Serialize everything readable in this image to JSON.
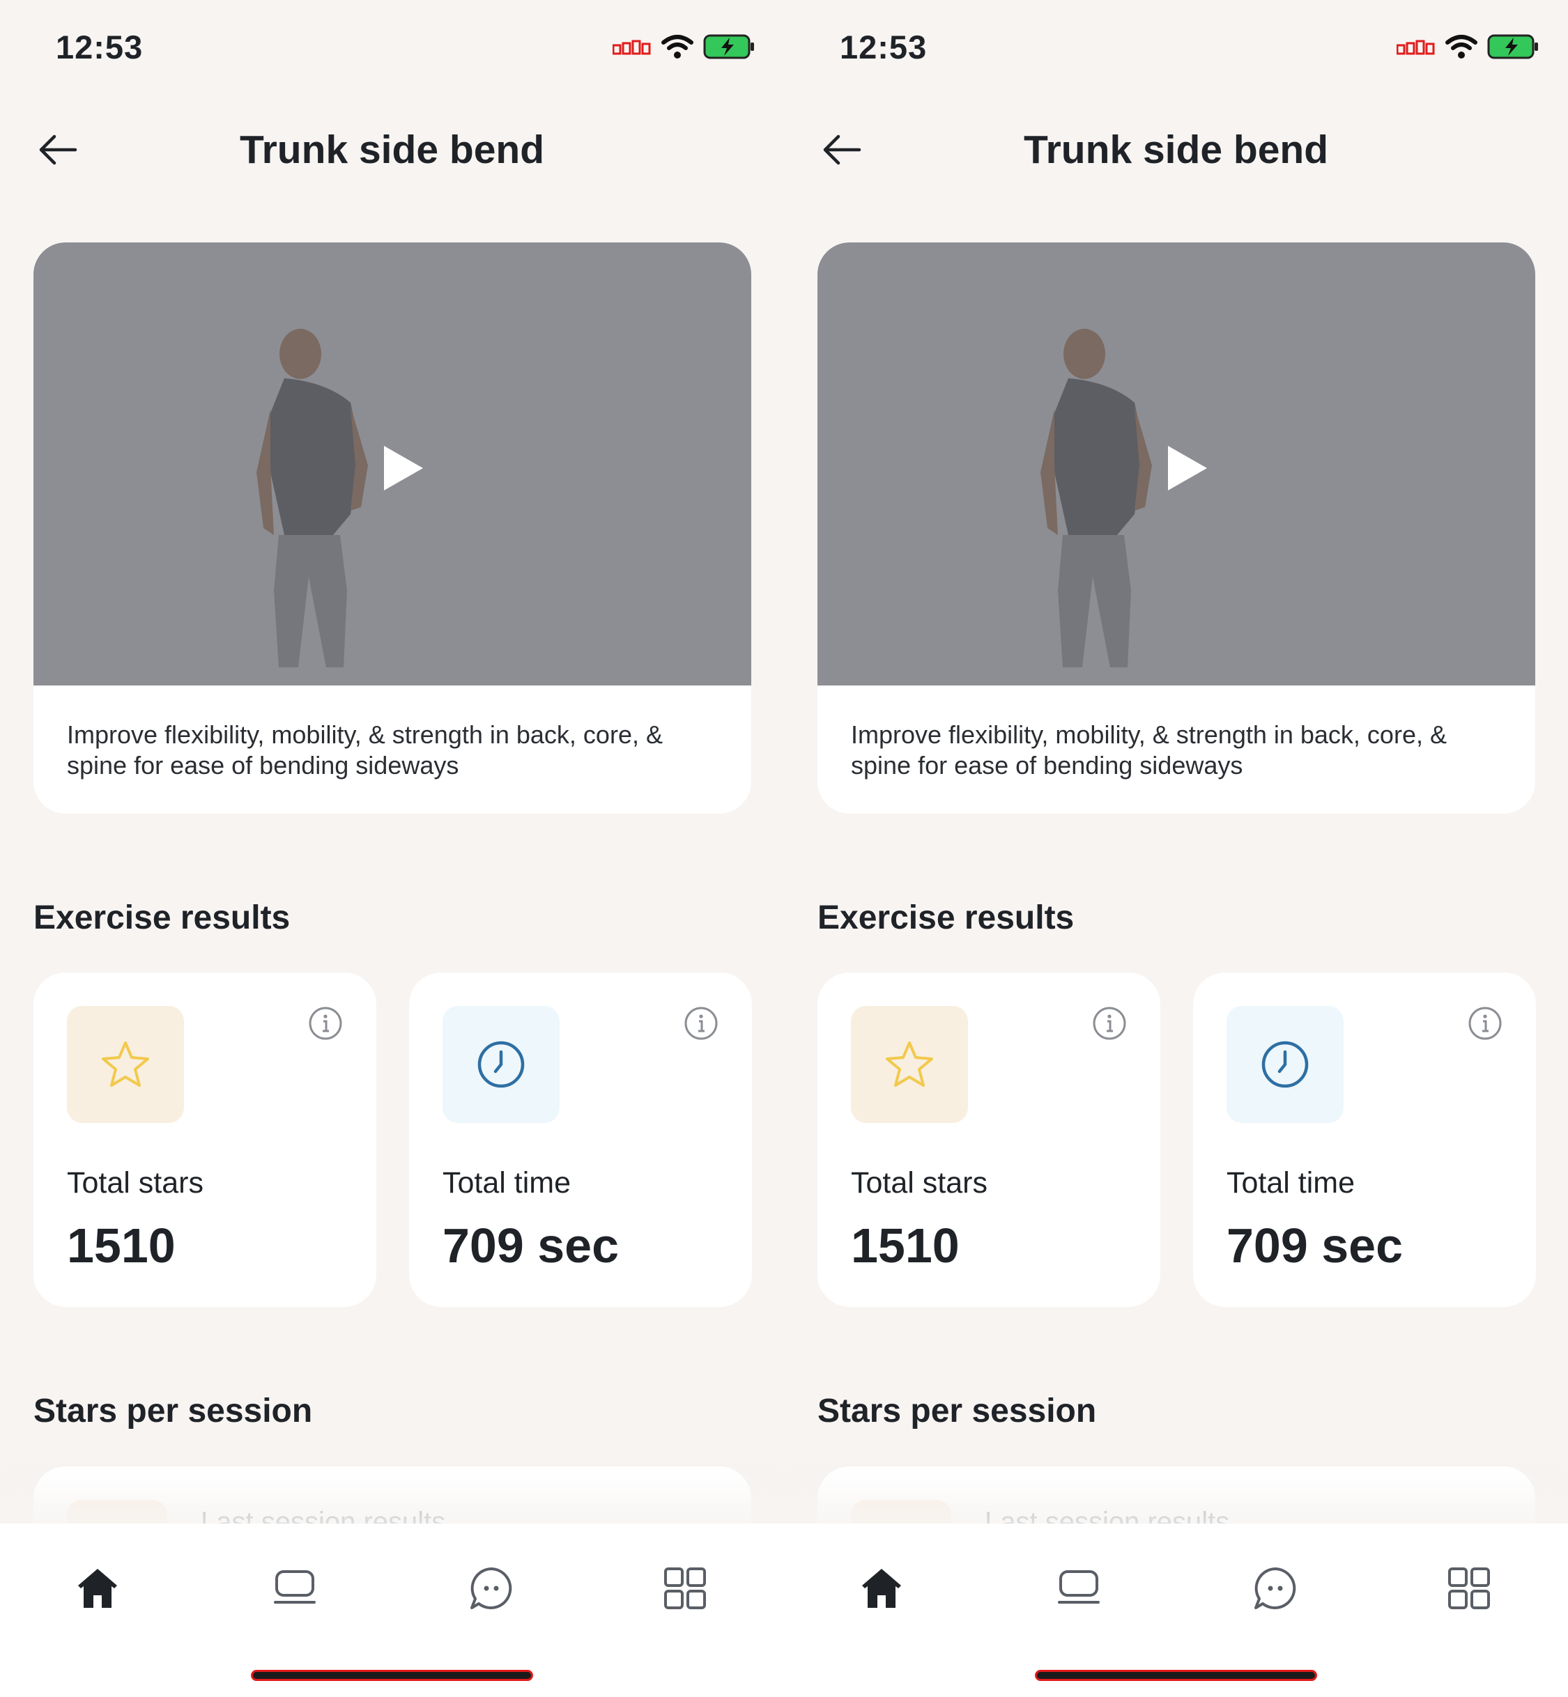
{
  "screens": [
    {
      "status": {
        "time": "12:53"
      },
      "header": {
        "title": "Trunk side bend"
      },
      "video": {
        "description": "Improve flexibility, mobility, & strength in back, core, & spine for ease of bending sideways"
      },
      "results": {
        "heading": "Exercise results",
        "stars": {
          "label": "Total stars",
          "value": "1510"
        },
        "time": {
          "label": "Total time",
          "value": "709 sec"
        }
      },
      "session": {
        "heading": "Stars per session",
        "card_label": "Last session results"
      }
    },
    {
      "status": {
        "time": "12:53"
      },
      "header": {
        "title": "Trunk side bend"
      },
      "video": {
        "description": "Improve flexibility, mobility, & strength in back, core, & spine for ease of bending sideways"
      },
      "results": {
        "heading": "Exercise results",
        "stars": {
          "label": "Total stars",
          "value": "1510"
        },
        "time": {
          "label": "Total time",
          "value": "709 sec"
        }
      },
      "session": {
        "heading": "Stars per session",
        "card_label": "Last session results"
      }
    }
  ],
  "colors": {
    "background": "#f7f4f2",
    "card": "#ffffff",
    "star_accent": "#f2c94c",
    "clock_accent": "#2d6fa3",
    "battery_green": "#34c759",
    "signal_red": "#e01b1b"
  },
  "icons": {
    "back": "arrow-left-icon",
    "play": "play-icon",
    "star": "star-icon",
    "clock": "clock-icon",
    "info": "info-icon",
    "nav": [
      "home-icon",
      "device-icon",
      "chat-icon",
      "grid-icon"
    ]
  }
}
